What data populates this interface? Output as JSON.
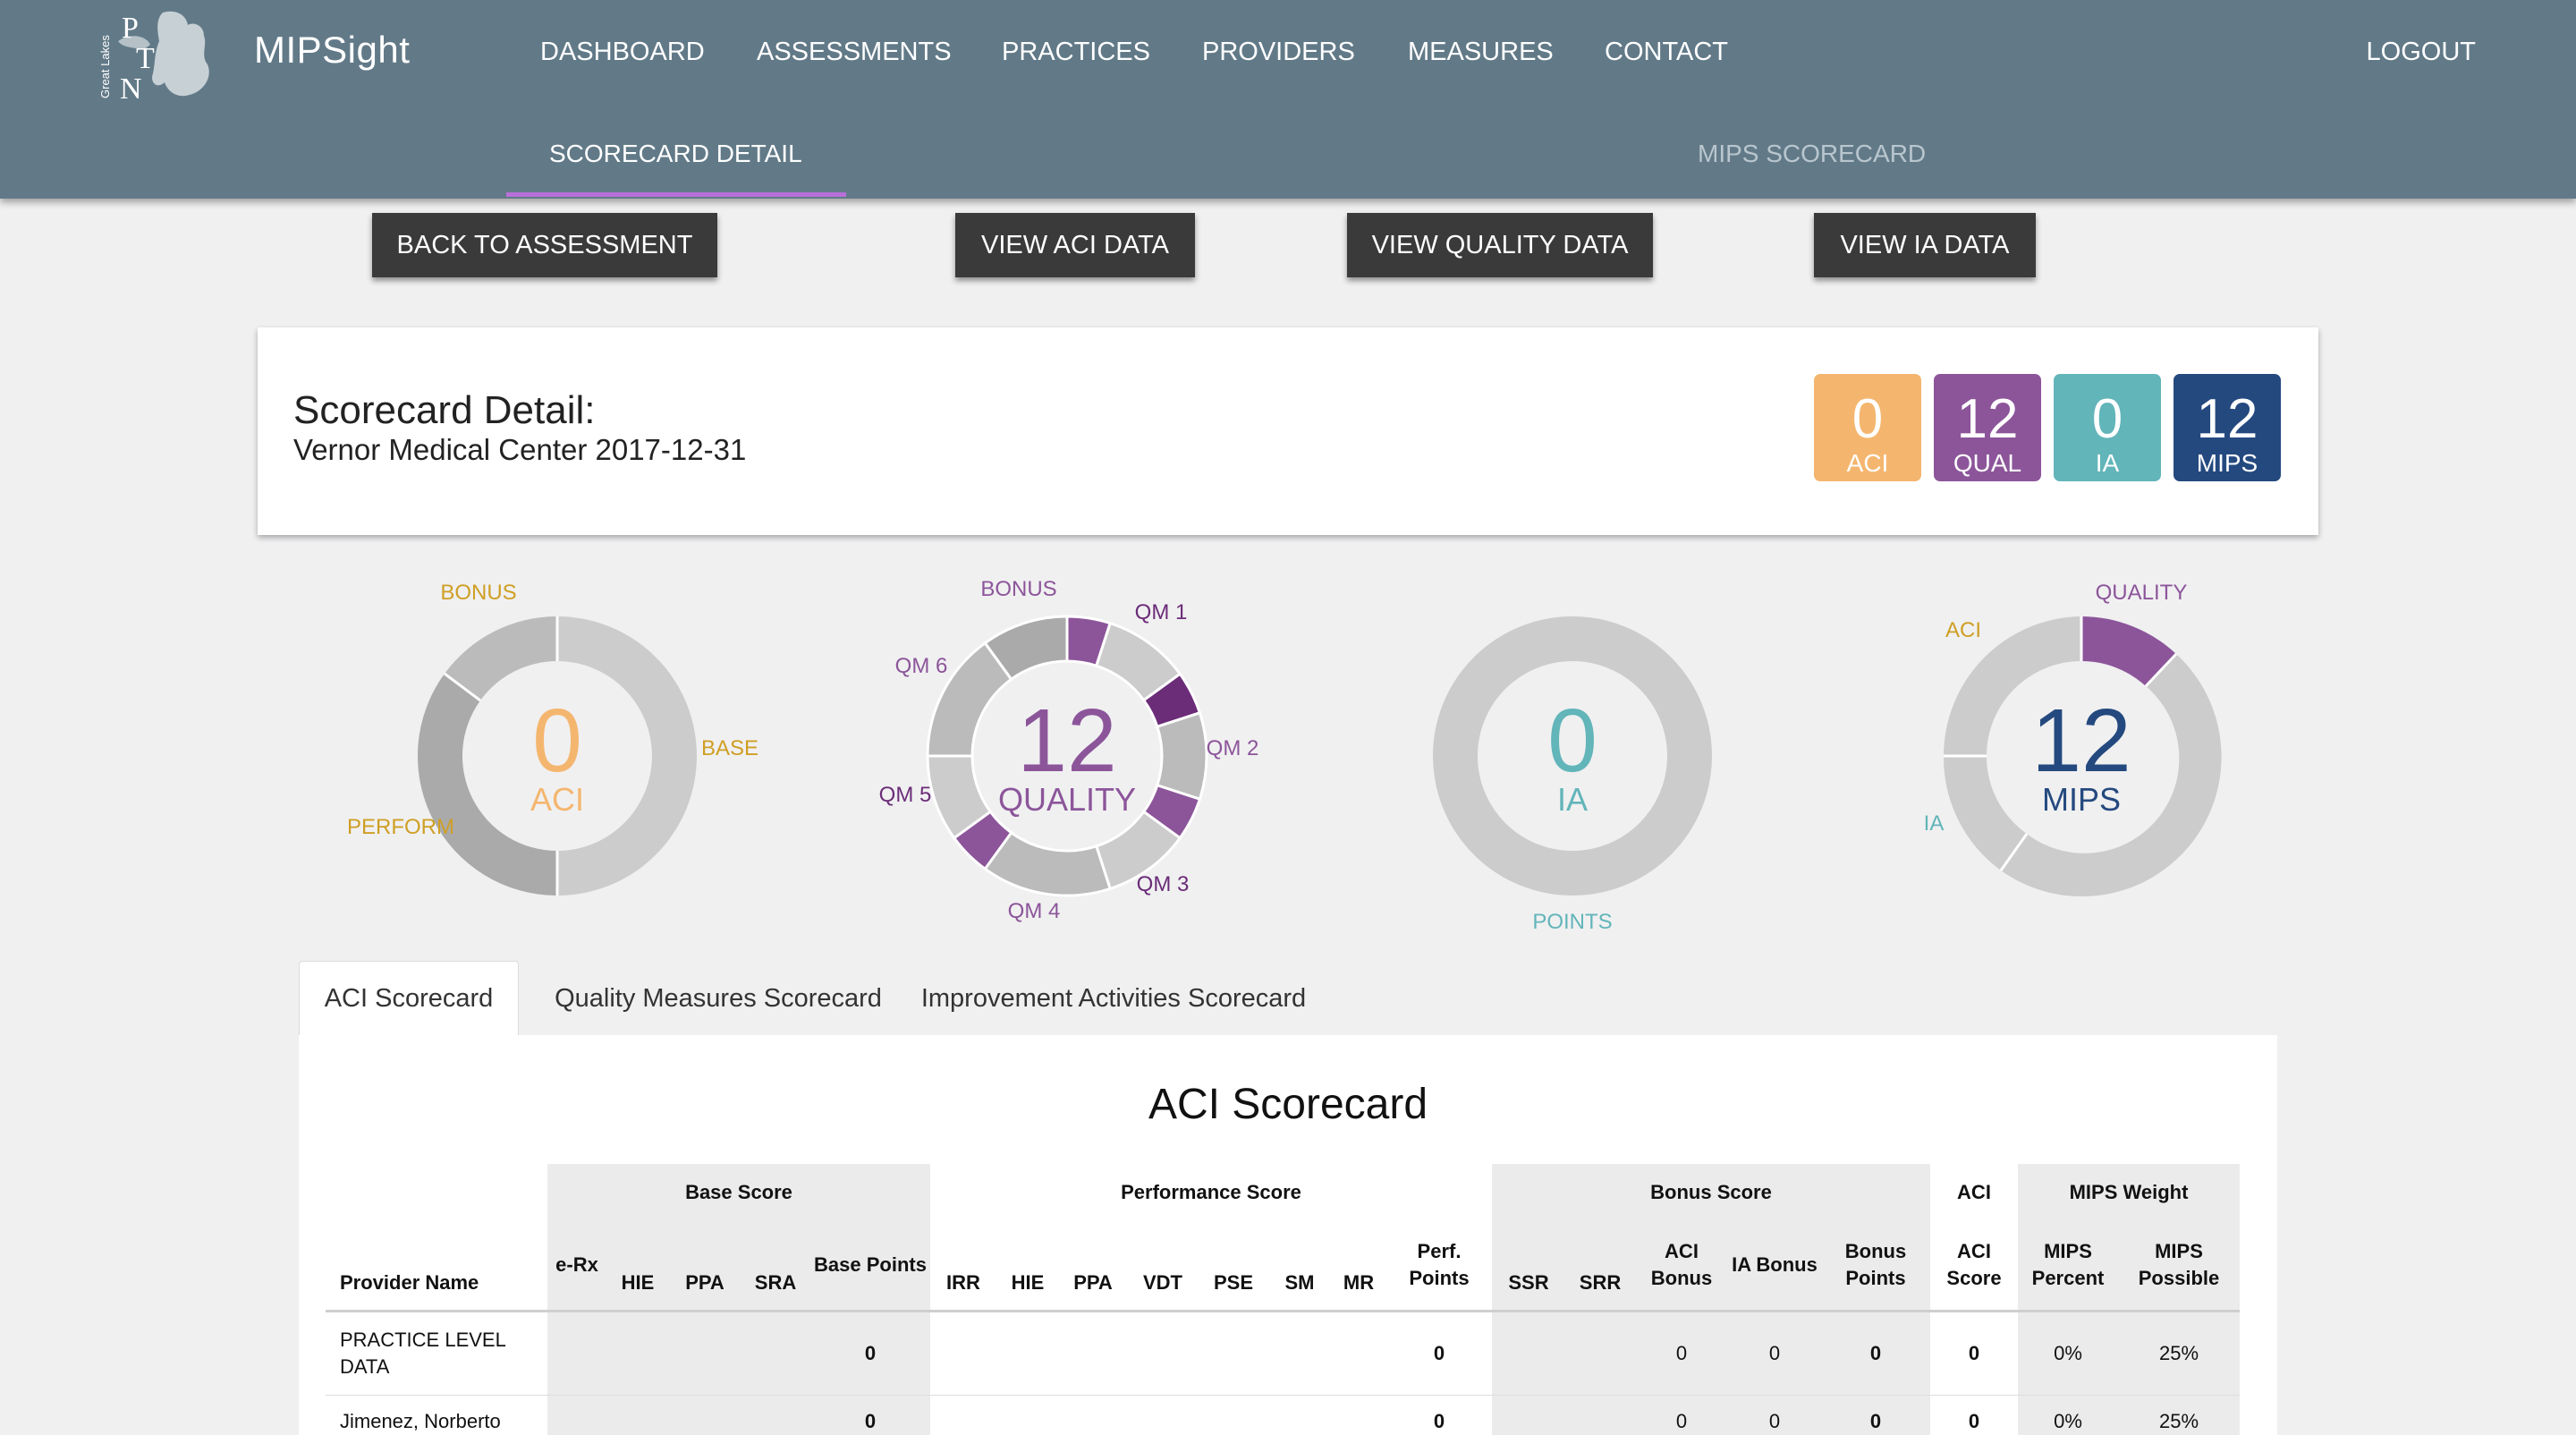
{
  "app": {
    "brand": "MIPSight",
    "logo_letters": [
      "P",
      "T",
      "N"
    ],
    "logo_side_text": "Great Lakes"
  },
  "nav": {
    "items": [
      "DASHBOARD",
      "ASSESSMENTS",
      "PRACTICES",
      "PROVIDERS",
      "MEASURES",
      "CONTACT"
    ],
    "logout": "LOGOUT"
  },
  "subtabs": {
    "active": "SCORECARD DETAIL",
    "inactive": "MIPS SCORECARD"
  },
  "actions": {
    "back": "BACK TO ASSESSMENT",
    "aci": "VIEW ACI DATA",
    "quality": "VIEW QUALITY DATA",
    "ia": "VIEW IA DATA"
  },
  "scorecard": {
    "title": "Scorecard Detail:",
    "subtitle": "Vernor Medical Center 2017-12-31",
    "tiles": [
      {
        "value": "0",
        "label": "ACI",
        "color": "#f4b66f"
      },
      {
        "value": "12",
        "label": "QUAL",
        "color": "#8c559a"
      },
      {
        "value": "0",
        "label": "IA",
        "color": "#62b5b9"
      },
      {
        "value": "12",
        "label": "MIPS",
        "color": "#24497f"
      }
    ]
  },
  "colors": {
    "aci": "#f4b66f",
    "aci_label": "#cf9f24",
    "quality": "#8c559a",
    "quality_dark": "#6b2c78",
    "ia": "#62b5b9",
    "mips": "#24497f",
    "gray_light": "#cccccc",
    "gray_mid": "#bbbbbb",
    "gray_dark": "#aaaaaa"
  },
  "donuts": {
    "aci": {
      "value": "0",
      "label": "ACI",
      "slice_labels": [
        "BONUS",
        "BASE",
        "PERFORM"
      ]
    },
    "quality": {
      "value": "12",
      "label": "QUALITY",
      "slice_labels": [
        "BONUS",
        "QM 1",
        "QM 2",
        "QM 3",
        "QM 4",
        "QM 5",
        "QM 6"
      ]
    },
    "ia": {
      "value": "0",
      "label": "IA",
      "slice_labels": [
        "POINTS"
      ]
    },
    "mips": {
      "value": "12",
      "label": "MIPS",
      "slice_labels": [
        "QUALITY",
        "ACI",
        "IA"
      ]
    }
  },
  "tabs": [
    "ACI Scorecard",
    "Quality Measures Scorecard",
    "Improvement Activities Scorecard"
  ],
  "table": {
    "title": "ACI Scorecard",
    "groups": [
      "Base Score",
      "Performance Score",
      "Bonus Score",
      "ACI",
      "MIPS Weight"
    ],
    "columns": {
      "provider": "Provider Name",
      "base": [
        "e-Rx",
        "HIE",
        "PPA",
        "SRA",
        "Base Points"
      ],
      "perf": [
        "IRR",
        "HIE",
        "PPA",
        "VDT",
        "PSE",
        "SM",
        "MR",
        "Perf. Points"
      ],
      "bonus": [
        "SSR",
        "SRR",
        "ACI Bonus",
        "IA Bonus",
        "Bonus Points"
      ],
      "aci": [
        "ACI Score"
      ],
      "mips": [
        "MIPS Percent",
        "MIPS Possible"
      ]
    },
    "rows": [
      {
        "name": "PRACTICE LEVEL DATA",
        "base_points": "0",
        "perf_points": "0",
        "aci_bonus": "0",
        "ia_bonus": "0",
        "bonus_points": "0",
        "aci_score": "0",
        "mips_percent": "0%",
        "mips_possible": "25%"
      },
      {
        "name": "Jimenez, Norberto",
        "base_points": "0",
        "perf_points": "0",
        "aci_bonus": "0",
        "ia_bonus": "0",
        "bonus_points": "0",
        "aci_score": "0",
        "mips_percent": "0%",
        "mips_possible": "25%"
      }
    ]
  }
}
